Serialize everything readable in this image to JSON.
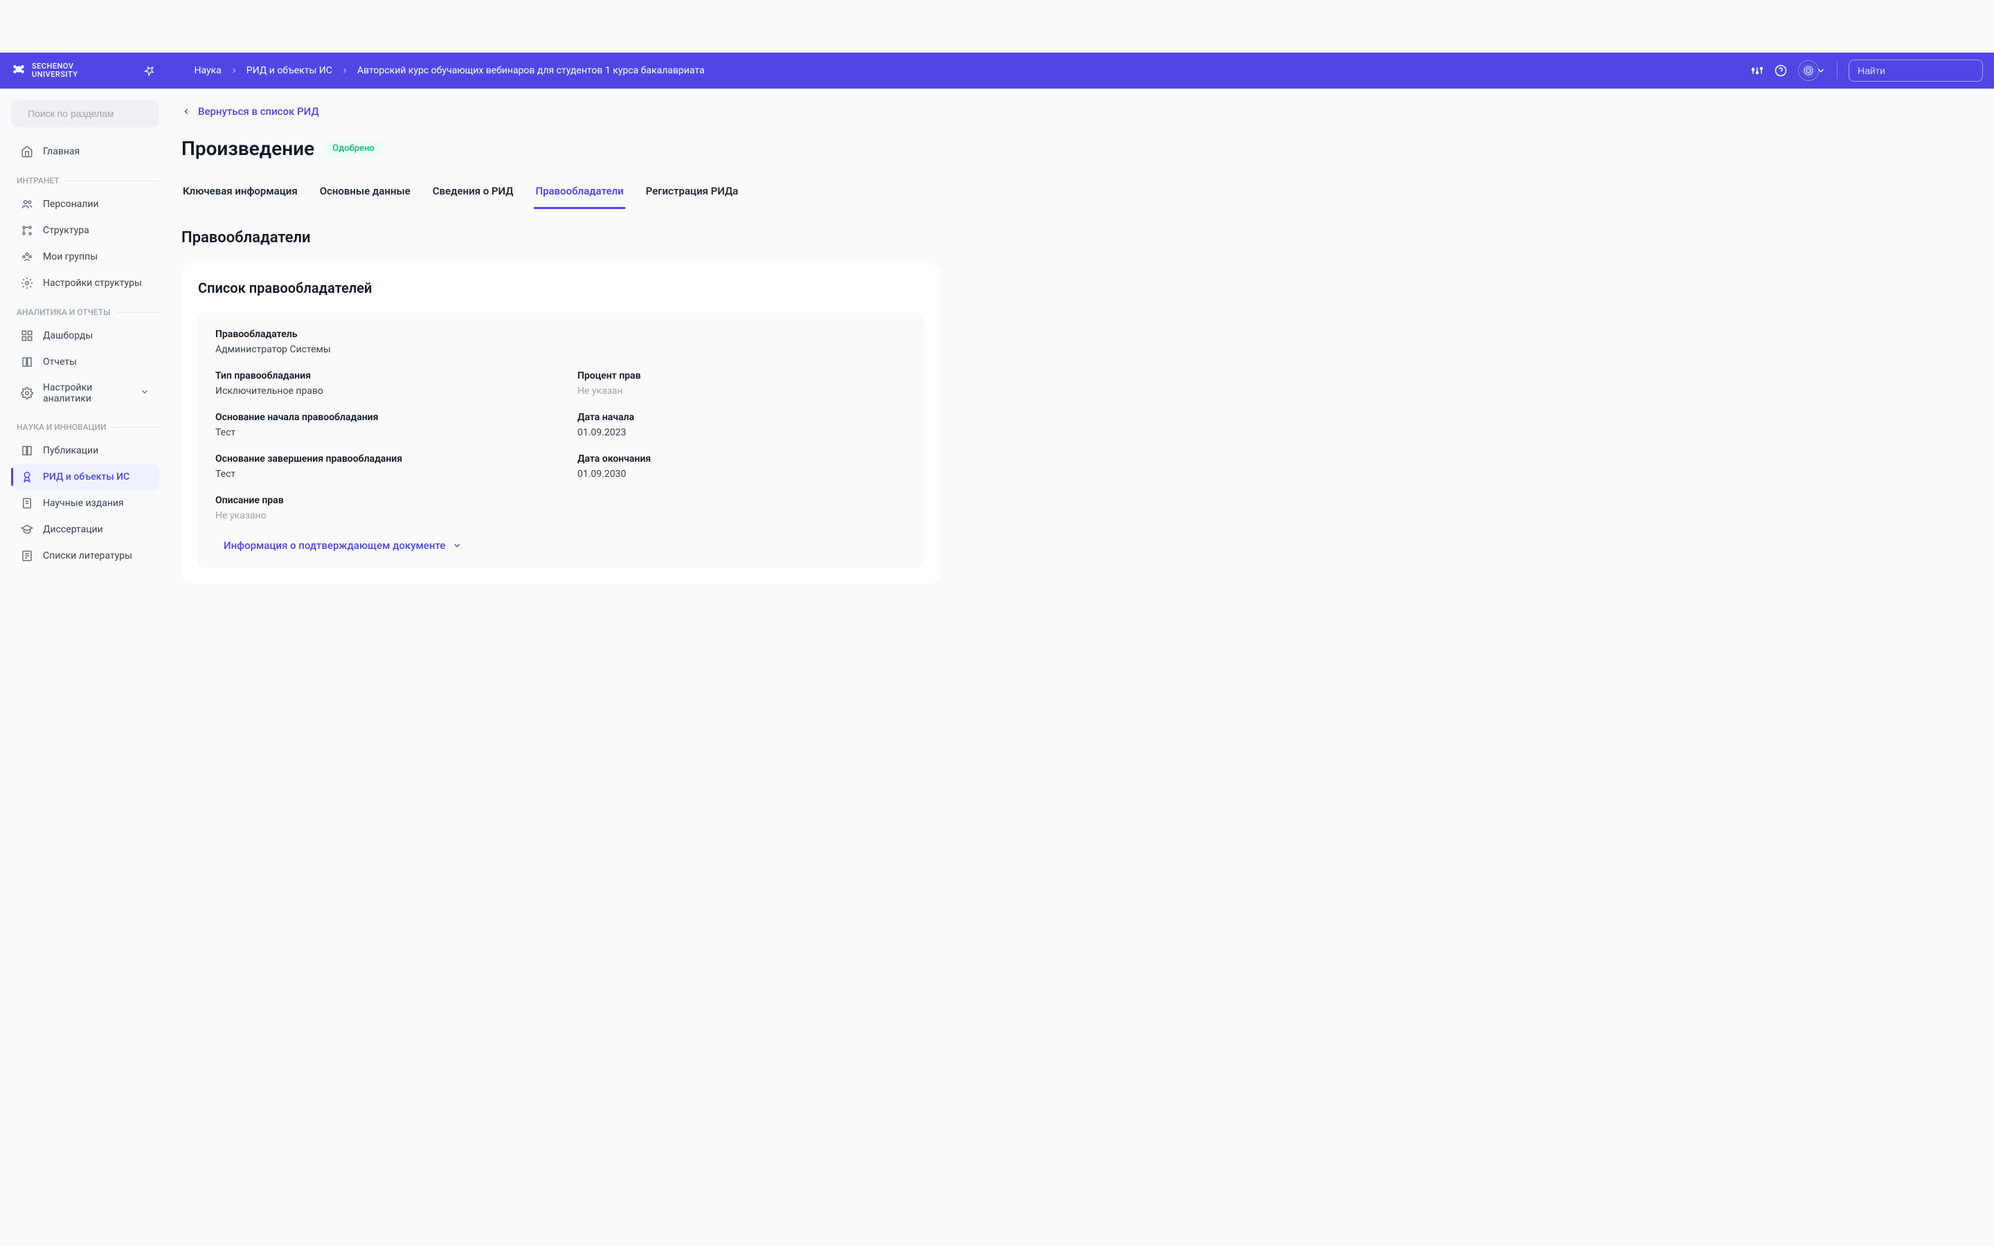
{
  "header": {
    "logo_line1": "SECHENOV",
    "logo_line2": "UNIVERSITY",
    "breadcrumb": [
      "Наука",
      "РИД и объекты ИС",
      "Авторский курс обучающих вебинаров для студентов 1 курса бакалавриата"
    ],
    "search_placeholder": "Найти"
  },
  "sidebar": {
    "search_placeholder": "Поиск по разделам",
    "home": "Главная",
    "sections": [
      {
        "label": "ИНТРАНЕТ",
        "items": [
          {
            "label": "Персоналии",
            "icon": "users"
          },
          {
            "label": "Структура",
            "icon": "structure"
          },
          {
            "label": "Мои группы",
            "icon": "groups"
          },
          {
            "label": "Настройки структуры",
            "icon": "gear"
          }
        ]
      },
      {
        "label": "АНАЛИТИКА И ОТЧЕТЫ",
        "items": [
          {
            "label": "Дашборды",
            "icon": "dashboard"
          },
          {
            "label": "Отчеты",
            "icon": "book"
          },
          {
            "label": "Настройки аналитики",
            "icon": "gear-complex",
            "has_chevron": true
          }
        ]
      },
      {
        "label": "НАУКА И ИННОВАЦИИ",
        "items": [
          {
            "label": "Публикации",
            "icon": "book"
          },
          {
            "label": "РИД и объекты ИС",
            "icon": "award",
            "active": true
          },
          {
            "label": "Научные издания",
            "icon": "journal"
          },
          {
            "label": "Диссертации",
            "icon": "graduation"
          },
          {
            "label": "Списки литературы",
            "icon": "list"
          }
        ]
      }
    ]
  },
  "content": {
    "back_link": "Вернуться в список РИД",
    "title": "Произведение",
    "status": "Одобрено",
    "tabs": [
      "Ключевая информация",
      "Основные данные",
      "Сведения о РИД",
      "Правообладатели",
      "Регистрация РИДа"
    ],
    "active_tab_index": 3,
    "section_heading": "Правообладатели",
    "card_title": "Список правообладателей",
    "rights_holder": {
      "label_holder": "Правообладатель",
      "value_holder": "Администратор Системы",
      "label_type": "Тип правообладания",
      "value_type": "Исключительное право",
      "label_percent": "Процент прав",
      "value_percent": "Не указан",
      "label_basis_start": "Основание начала правообладания",
      "value_basis_start": "Тест",
      "label_date_start": "Дата начала",
      "value_date_start": "01.09.2023",
      "label_basis_end": "Основание завершения правообладания",
      "value_basis_end": "Тест",
      "label_date_end": "Дата окончания",
      "value_date_end": "01.09.2030",
      "label_description": "Описание прав",
      "value_description": "Не указано",
      "doc_toggle": "Информация о подтверждающем документе"
    }
  }
}
